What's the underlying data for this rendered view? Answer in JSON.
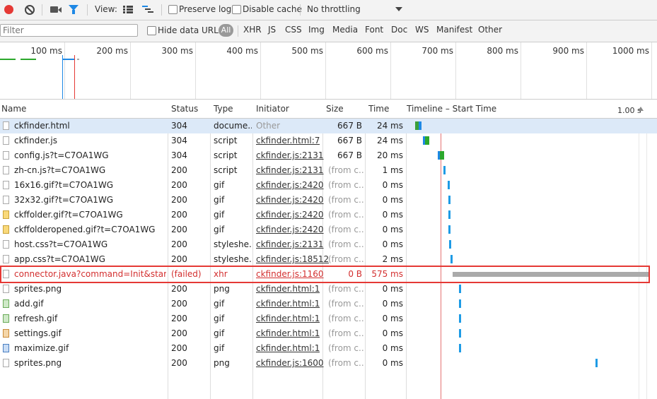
{
  "toolbar": {
    "record_icon": "record-icon",
    "clear_icon": "clear-icon",
    "camera_icon": "camera-icon",
    "filter_icon": "filter-icon",
    "view_label": "View:",
    "preserve_log_label": "Preserve log",
    "disable_cache_label": "Disable cache",
    "throttling_value": "No throttling",
    "colors": {
      "record": "#e53935",
      "filter_active": "#1e88e5"
    }
  },
  "filterbar": {
    "placeholder": "Filter",
    "hide_data_urls_label": "Hide data URLs",
    "all_label": "All",
    "types": [
      "XHR",
      "JS",
      "CSS",
      "Img",
      "Media",
      "Font",
      "Doc",
      "WS",
      "Manifest",
      "Other"
    ]
  },
  "overview": {
    "ticks": [
      "100 ms",
      "200 ms",
      "300 ms",
      "400 ms",
      "500 ms",
      "600 ms",
      "700 ms",
      "800 ms",
      "900 ms",
      "1000 ms"
    ]
  },
  "table": {
    "headers": {
      "name": "Name",
      "status": "Status",
      "type": "Type",
      "initiator": "Initiator",
      "size": "Size",
      "time": "Time",
      "timeline": "Timeline – Start Time",
      "timeline_end": "1.00 s"
    },
    "rows": [
      {
        "name": "ckfinder.html",
        "status": "304",
        "type": "docume...",
        "initiator": "Other",
        "size": "667 B",
        "time": "24 ms",
        "icon": "document-icon"
      },
      {
        "name": "ckfinder.js",
        "status": "304",
        "type": "script",
        "initiator": "ckfinder.html:7",
        "size": "667 B",
        "time": "24 ms",
        "icon": "script-icon"
      },
      {
        "name": "config.js?t=C7OA1WG",
        "status": "304",
        "type": "script",
        "initiator": "ckfinder.js:2131",
        "size": "667 B",
        "time": "20 ms",
        "icon": "script-icon"
      },
      {
        "name": "zh-cn.js?t=C7OA1WG",
        "status": "200",
        "type": "script",
        "initiator": "ckfinder.js:2131",
        "size": "(from c...",
        "time": "1 ms",
        "icon": "script-icon"
      },
      {
        "name": "16x16.gif?t=C7OA1WG",
        "status": "200",
        "type": "gif",
        "initiator": "ckfinder.js:2420",
        "size": "(from c...",
        "time": "0 ms",
        "icon": "image-icon"
      },
      {
        "name": "32x32.gif?t=C7OA1WG",
        "status": "200",
        "type": "gif",
        "initiator": "ckfinder.js:2420",
        "size": "(from c...",
        "time": "0 ms",
        "icon": "image-icon"
      },
      {
        "name": "ckffolder.gif?t=C7OA1WG",
        "status": "200",
        "type": "gif",
        "initiator": "ckfinder.js:2420",
        "size": "(from c...",
        "time": "0 ms",
        "icon": "folder-icon"
      },
      {
        "name": "ckffolderopened.gif?t=C7OA1WG",
        "status": "200",
        "type": "gif",
        "initiator": "ckfinder.js:2420",
        "size": "(from c...",
        "time": "0 ms",
        "icon": "folder-icon"
      },
      {
        "name": "host.css?t=C7OA1WG",
        "status": "200",
        "type": "styleshe...",
        "initiator": "ckfinder.js:2131",
        "size": "(from c...",
        "time": "0 ms",
        "icon": "stylesheet-icon"
      },
      {
        "name": "app.css?t=C7OA1WG",
        "status": "200",
        "type": "styleshe...",
        "initiator": "ckfinder.js:18512",
        "size": "(from c...",
        "time": "2 ms",
        "icon": "stylesheet-icon"
      },
      {
        "name": "connector.java?command=Init&startu...",
        "status": "(failed)",
        "type": "xhr",
        "initiator": "ckfinder.js:1160",
        "size": "0 B",
        "time": "575 ms",
        "icon": "xhr-icon"
      },
      {
        "name": "sprites.png",
        "status": "200",
        "type": "png",
        "initiator": "ckfinder.html:1",
        "size": "(from c...",
        "time": "0 ms",
        "icon": "image-icon"
      },
      {
        "name": "add.gif",
        "status": "200",
        "type": "gif",
        "initiator": "ckfinder.html:1",
        "size": "(from c...",
        "time": "0 ms",
        "icon": "image-icon"
      },
      {
        "name": "refresh.gif",
        "status": "200",
        "type": "gif",
        "initiator": "ckfinder.html:1",
        "size": "(from c...",
        "time": "0 ms",
        "icon": "image-icon"
      },
      {
        "name": "settings.gif",
        "status": "200",
        "type": "gif",
        "initiator": "ckfinder.html:1",
        "size": "(from c...",
        "time": "0 ms",
        "icon": "image-icon"
      },
      {
        "name": "maximize.gif",
        "status": "200",
        "type": "gif",
        "initiator": "ckfinder.html:1",
        "size": "(from c...",
        "time": "0 ms",
        "icon": "image-icon"
      },
      {
        "name": "sprites.png",
        "status": "200",
        "type": "png",
        "initiator": "ckfinder.js:1600",
        "size": "(from c...",
        "time": "0 ms",
        "icon": "image-icon"
      }
    ]
  }
}
